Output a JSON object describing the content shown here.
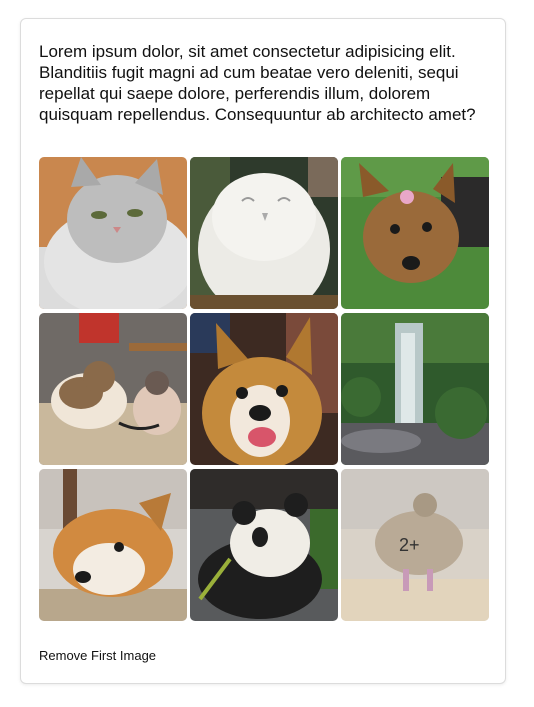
{
  "paragraph": "Lorem ipsum dolor, sit amet consectetur adipisicing elit. Blanditiis fugit magni ad cum beatae vero deleniti, sequi repellat qui saepe dolore, perferendis illum, dolorem quisquam repellendus. Consequuntur ab architecto amet?",
  "gallery": {
    "images": [
      {
        "subject": "gray-persian-cat"
      },
      {
        "subject": "white-owl"
      },
      {
        "subject": "yorkshire-terrier-on-grass"
      },
      {
        "subject": "two-cats-on-floor"
      },
      {
        "subject": "corgi-selfie"
      },
      {
        "subject": "waterfall-garden"
      },
      {
        "subject": "corgi-lying-down"
      },
      {
        "subject": "panda-eating-bamboo"
      },
      {
        "subject": "duck-in-enclosure",
        "overlay_text": "2+"
      }
    ]
  },
  "actions": {
    "remove_label": "Remove First Image"
  },
  "colors": {
    "card_border": "#dcdcdc",
    "text": "#111111",
    "background": "#ffffff"
  }
}
